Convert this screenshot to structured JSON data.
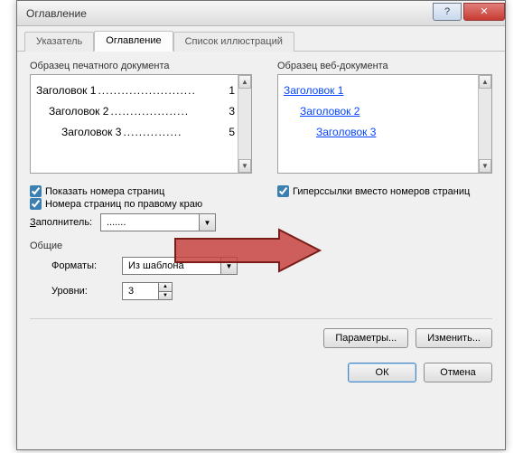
{
  "window": {
    "title": "Оглавление"
  },
  "tabs": {
    "0": {
      "label": "Указатель"
    },
    "1": {
      "label": "Оглавление"
    },
    "2": {
      "label": "Список иллюстраций"
    }
  },
  "left": {
    "label": "Образец печатного документа",
    "row1": {
      "text": "Заголовок 1",
      "page": "1"
    },
    "row2": {
      "text": "Заголовок 2",
      "page": "3"
    },
    "row3": {
      "text": "Заголовок 3",
      "page": "5"
    },
    "chk_show": "Показать номера страниц",
    "chk_align": "Номера страниц по правому краю",
    "filler_label": "Заполнитель:",
    "filler_value": "......."
  },
  "right": {
    "label": "Образец веб-документа",
    "h1": "Заголовок 1",
    "h2": "Заголовок 2",
    "h3": "Заголовок 3",
    "chk_hyper": "Гиперссылки вместо номеров страниц"
  },
  "general": {
    "label": "Общие",
    "formats_label": "Форматы:",
    "formats_value": "Из шаблона",
    "levels_label": "Уровни:",
    "levels_value": "3"
  },
  "buttons": {
    "params": "Параметры...",
    "modify": "Изменить...",
    "ok": "ОК",
    "cancel": "Отмена"
  },
  "accessibility": {
    "first_letter_z": "З"
  }
}
